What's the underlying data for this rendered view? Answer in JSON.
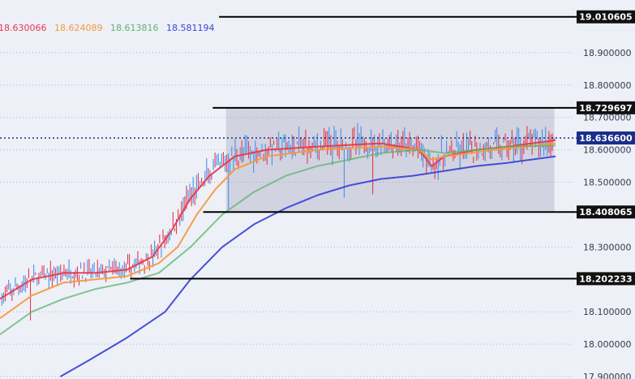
{
  "chart_data": {
    "type": "candlestick",
    "title": "",
    "ylim": [
      17.9,
      19.02
    ],
    "y_ticks": [
      "18.900000",
      "18.800000",
      "18.700000",
      "18.600000",
      "18.500000",
      "18.300000",
      "18.100000",
      "18.000000",
      "17.900000"
    ],
    "legend": {
      "items": [
        {
          "text": "18.630066",
          "color": "#e8394a"
        },
        {
          "text": "18.624089",
          "color": "#f59a3a"
        },
        {
          "text": "18.613816",
          "color": "#5bb56b"
        },
        {
          "text": "18.581194",
          "color": "#3b47d6"
        }
      ]
    },
    "price_levels": [
      {
        "value": 19.010605,
        "label": "19.010605",
        "x_start": 0.345
      },
      {
        "value": 18.729697,
        "label": "18.729697",
        "x_start": 0.335
      },
      {
        "value": 18.408065,
        "label": "18.408065",
        "x_start": 0.32
      },
      {
        "value": 18.202233,
        "label": "18.202233",
        "x_start": 0.205
      }
    ],
    "current_price": {
      "value": 18.6366,
      "label": "18.636600",
      "color": "#1a2e8a"
    },
    "range_box": {
      "y_low": 18.408065,
      "y_high": 18.729697,
      "x_start": 0.356,
      "x_end": 0.873
    },
    "moving_averages": [
      {
        "color": "#e8394a",
        "points": [
          [
            0,
            18.14
          ],
          [
            0.05,
            18.2
          ],
          [
            0.1,
            18.22
          ],
          [
            0.15,
            18.22
          ],
          [
            0.2,
            18.23
          ],
          [
            0.24,
            18.27
          ],
          [
            0.27,
            18.35
          ],
          [
            0.3,
            18.45
          ],
          [
            0.33,
            18.52
          ],
          [
            0.37,
            18.58
          ],
          [
            0.42,
            18.6
          ],
          [
            0.5,
            18.61
          ],
          [
            0.6,
            18.62
          ],
          [
            0.63,
            18.61
          ],
          [
            0.66,
            18.6
          ],
          [
            0.68,
            18.55
          ],
          [
            0.7,
            18.58
          ],
          [
            0.75,
            18.6
          ],
          [
            0.8,
            18.61
          ],
          [
            0.875,
            18.63
          ]
        ]
      },
      {
        "color": "#f59a3a",
        "points": [
          [
            0,
            18.08
          ],
          [
            0.05,
            18.15
          ],
          [
            0.1,
            18.19
          ],
          [
            0.15,
            18.2
          ],
          [
            0.2,
            18.21
          ],
          [
            0.25,
            18.25
          ],
          [
            0.28,
            18.3
          ],
          [
            0.31,
            18.4
          ],
          [
            0.34,
            18.48
          ],
          [
            0.37,
            18.54
          ],
          [
            0.42,
            18.58
          ],
          [
            0.5,
            18.6
          ],
          [
            0.6,
            18.61
          ],
          [
            0.66,
            18.6
          ],
          [
            0.68,
            18.57
          ],
          [
            0.7,
            18.58
          ],
          [
            0.78,
            18.6
          ],
          [
            0.875,
            18.62
          ]
        ]
      },
      {
        "color": "#5bb56b",
        "points": [
          [
            0,
            18.03
          ],
          [
            0.05,
            18.1
          ],
          [
            0.1,
            18.14
          ],
          [
            0.15,
            18.17
          ],
          [
            0.2,
            18.19
          ],
          [
            0.25,
            18.22
          ],
          [
            0.3,
            18.3
          ],
          [
            0.35,
            18.4
          ],
          [
            0.4,
            18.47
          ],
          [
            0.45,
            18.52
          ],
          [
            0.5,
            18.55
          ],
          [
            0.55,
            18.57
          ],
          [
            0.6,
            18.59
          ],
          [
            0.66,
            18.6
          ],
          [
            0.7,
            18.59
          ],
          [
            0.8,
            18.61
          ],
          [
            0.875,
            18.613
          ]
        ]
      },
      {
        "color": "#3b47d6",
        "points": [
          [
            0.095,
            17.9
          ],
          [
            0.14,
            17.95
          ],
          [
            0.2,
            18.02
          ],
          [
            0.26,
            18.1
          ],
          [
            0.3,
            18.2
          ],
          [
            0.35,
            18.3
          ],
          [
            0.4,
            18.37
          ],
          [
            0.45,
            18.42
          ],
          [
            0.5,
            18.46
          ],
          [
            0.55,
            18.49
          ],
          [
            0.6,
            18.51
          ],
          [
            0.65,
            18.52
          ],
          [
            0.7,
            18.535
          ],
          [
            0.75,
            18.55
          ],
          [
            0.8,
            18.56
          ],
          [
            0.875,
            18.58
          ]
        ]
      }
    ],
    "candle_colors": {
      "up": "#4a8fe8",
      "down": "#e8394a"
    }
  }
}
